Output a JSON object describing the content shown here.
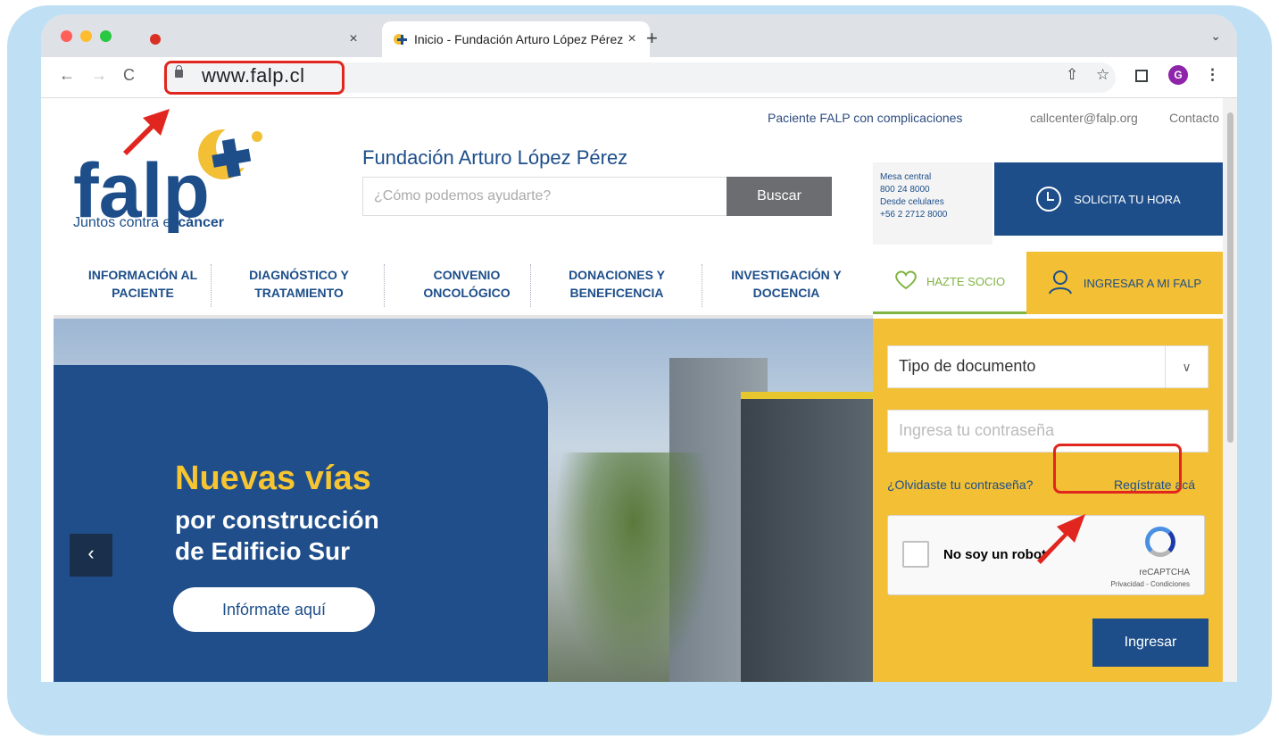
{
  "browser": {
    "tabs": [
      {
        "title": "",
        "active": false
      },
      {
        "title": "Inicio - Fundación Arturo López Pérez",
        "active": true
      }
    ],
    "url": "www.falp.cl"
  },
  "site": {
    "top_links": [
      "Paciente FALP con complicaciones",
      "callcenter@falp.org",
      "Contacto"
    ],
    "logo_text": "falp",
    "tagline": "Juntos contra el",
    "tagline_bold": "cáncer",
    "org_name": "Fundación Arturo López Pérez",
    "search_placeholder": "¿Cómo podemos ayudarte?",
    "search_button": "Buscar",
    "mesa": [
      "Mesa central",
      "800 24 8000",
      "Desde celulares",
      "+56 2 2712 8000"
    ],
    "solicita": "SOLICITA TU HORA",
    "menu": [
      [
        "INFORMACIÓN AL",
        "PACIENTE"
      ],
      [
        "DIAGNÓSTICO Y",
        "TRATAMIENTO"
      ],
      [
        "CONVENIO",
        "ONCOLÓGICO"
      ],
      [
        "DONACIONES Y",
        "BENEFICENCIA"
      ],
      [
        "INVESTIGACIÓN Y",
        "DOCENCIA"
      ]
    ],
    "socio": "HAZTE SOCIO",
    "ingresar_tab": "INGRESAR A MI FALP",
    "hero": {
      "title": "Nuevas vías",
      "sub1": "por construcción",
      "sub2": "de Edificio Sur",
      "button": "Infórmate aquí",
      "prev": "‹"
    },
    "login": {
      "doc_type": "Tipo de documento",
      "password_placeholder": "Ingresa tu contraseña",
      "forgot": "¿Olvidaste tu contraseña?",
      "register": "Regístrate acá",
      "captcha_label": "No soy un robot",
      "captcha_brand": "reCAPTCHA",
      "captcha_links": "Privacidad - Condiciones",
      "submit": "Ingresar"
    }
  },
  "colors": {
    "falp_blue": "#1d4e8a",
    "falp_yellow": "#f2bf35",
    "highlight": "#e0261e"
  }
}
